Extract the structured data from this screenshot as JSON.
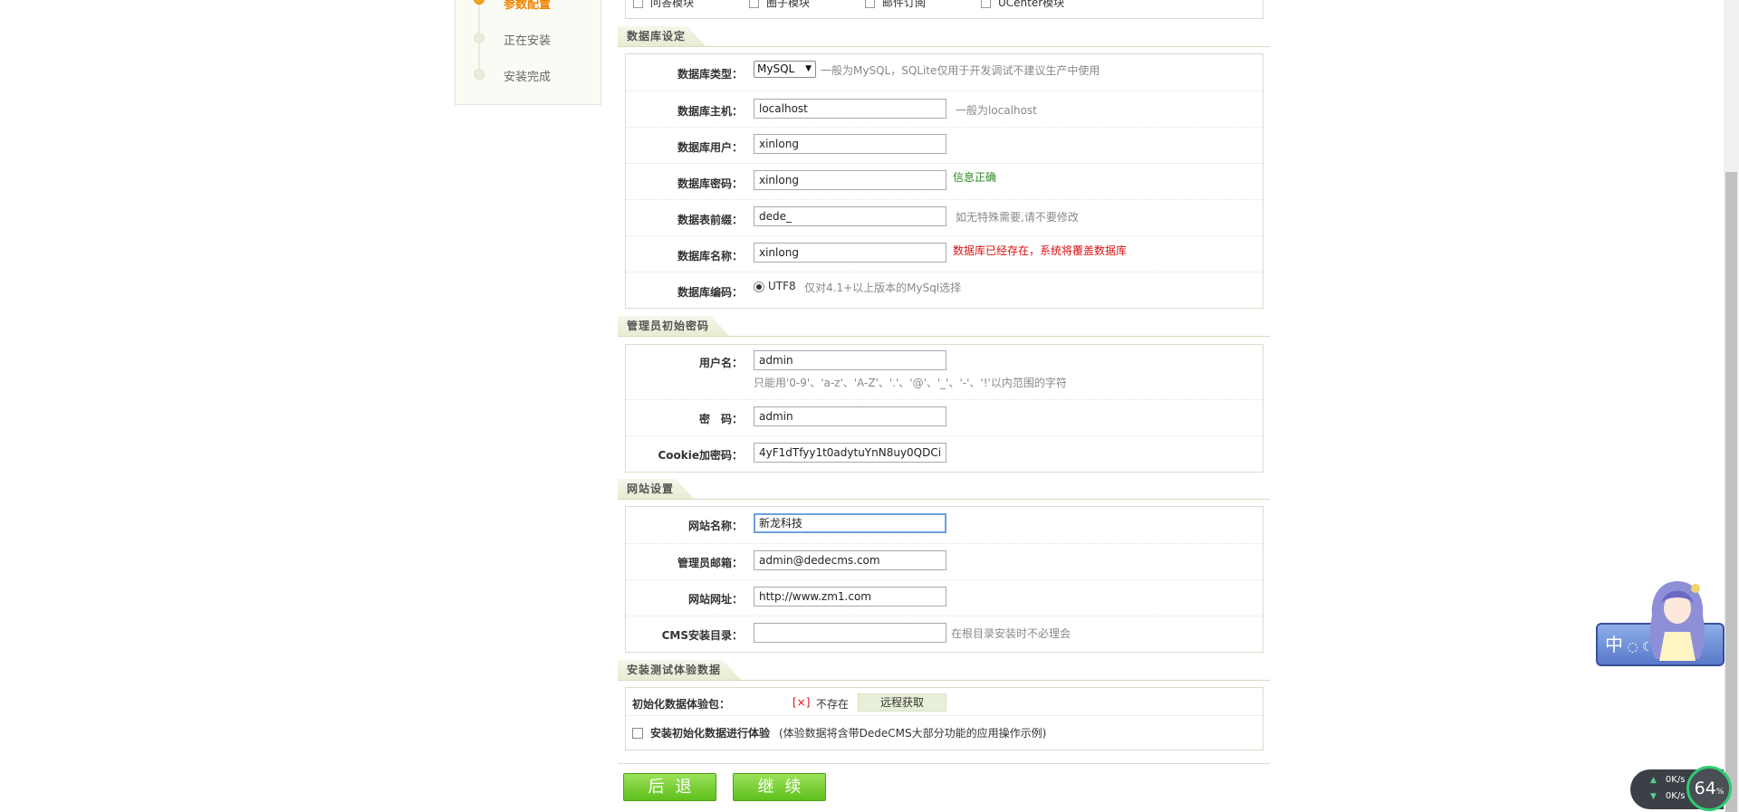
{
  "steps": [
    {
      "label": "参数配置"
    },
    {
      "label": "正在安装"
    },
    {
      "label": "安装完成"
    }
  ],
  "modules": [
    "问答模块",
    "圈子模块",
    "邮件订阅",
    "UCenter模块"
  ],
  "db_section": {
    "title": "数据库设定",
    "type_label": "数据库类型：",
    "type_value": "MySQL",
    "type_tip": "一般为MySQL，SQLite仅用于开发调试不建议生产中使用",
    "host_label": "数据库主机：",
    "host_value": "localhost",
    "host_tip": "一般为localhost",
    "user_label": "数据库用户：",
    "user_value": "xinlong",
    "pwd_label": "数据库密码：",
    "pwd_value": "xinlong",
    "pwd_tip": "信息正确",
    "prefix_label": "数据表前缀：",
    "prefix_value": "dede_",
    "prefix_tip": "如无特殊需要,请不要修改",
    "name_label": "数据库名称：",
    "name_value": "xinlong",
    "name_tip": "数据库已经存在，系统将覆盖数据库",
    "charset_label": "数据库编码：",
    "charset_value": "UTF8",
    "charset_tip": "仅对4.1+以上版本的MySql选择"
  },
  "admin_section": {
    "title": "管理员初始密码",
    "username_label": "用户名：",
    "username_value": "admin",
    "username_tip": "只能用'0-9'、'a-z'、'A-Z'、'.'、'@'、'_'、'-'、'!'以内范围的字符",
    "password_label": "密　码：",
    "password_value": "admin",
    "cookie_label": "Cookie加密码：",
    "cookie_value": "4yF1dTfyy1t0adytuYnN8uy0QDCi"
  },
  "site_section": {
    "title": "网站设置",
    "name_label": "网站名称：",
    "name_value": "新龙科技",
    "email_label": "管理员邮箱：",
    "email_value": "admin@dedecms.com",
    "url_label": "网站网址：",
    "url_value": "http://www.zm1.com",
    "dir_label": "CMS安装目录：",
    "dir_value": "",
    "dir_tip": "在根目录安装时不必理会"
  },
  "demo_section": {
    "title": "安装测试体验数据",
    "pkg_label": "初始化数据体验包：",
    "pkg_status_mark": "[×]",
    "pkg_status": "不存在",
    "fetch_label": "远程获取",
    "install_demo_label": "安装初始化数据进行体验",
    "install_demo_note": "(体验数据将含带DedeCMS大部分功能的应用操作示例)"
  },
  "buttons": {
    "back": "后退",
    "continue": "继续"
  },
  "overlay": {
    "ime_text": "中",
    "net_up": "0K/s",
    "net_down": "0K/s",
    "gauge_value": "64",
    "gauge_unit": "%"
  }
}
